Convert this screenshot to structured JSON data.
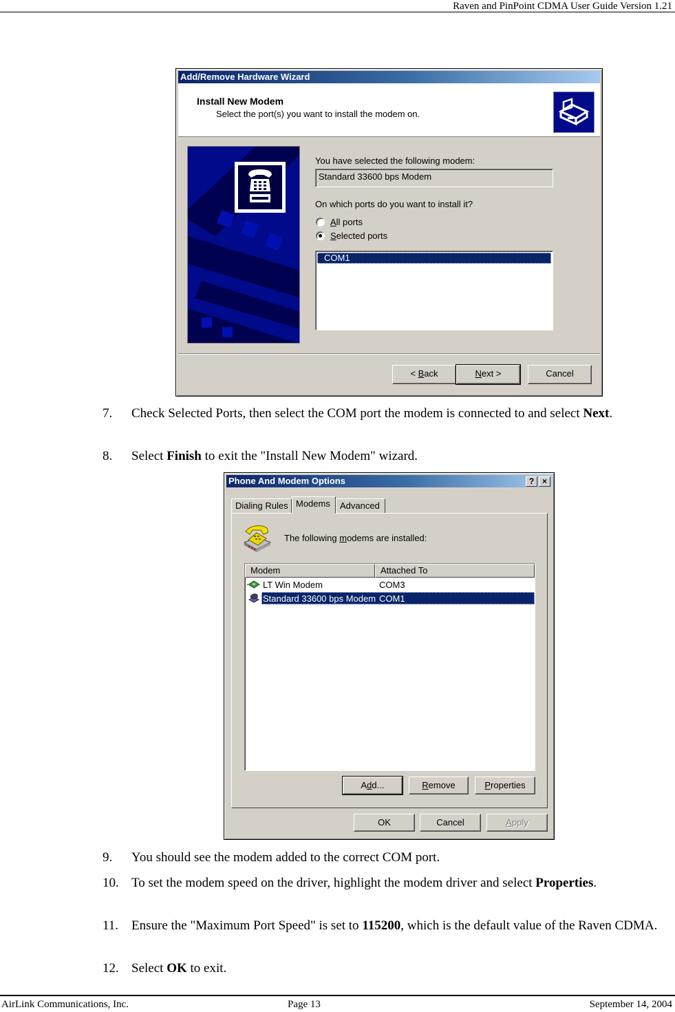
{
  "page": {
    "header": "Raven and PinPoint CDMA User Guide Version 1.21",
    "footer": {
      "company": "AirLink Communications, Inc.",
      "page": "Page 13",
      "date": "September 14, 2004"
    }
  },
  "wizard": {
    "title": "Add/Remove Hardware Wizard",
    "heading": "Install New Modem",
    "subheading": "Select the port(s) you want to install the modem on.",
    "selected_modem_label": "You have selected the following modem:",
    "selected_modem_value": "Standard 33600 bps Modem",
    "ports_question": "On which ports do you want to install it?",
    "radio_options": [
      {
        "label": "All ports",
        "accel": "A",
        "rest": "ll ports",
        "checked": false
      },
      {
        "label": "Selected ports",
        "accel": "S",
        "rest": "elected ports",
        "checked": true
      }
    ],
    "ports": [
      {
        "name": "COM1",
        "selected": true
      }
    ],
    "buttons": {
      "back": {
        "prefix": "< ",
        "accel": "B",
        "rest": "ack"
      },
      "next": {
        "accel": "N",
        "rest": "ext >"
      },
      "cancel": "Cancel"
    },
    "icons": {
      "header": "hardware-drive-icon",
      "art": "telephone-icon"
    }
  },
  "steps_a": [
    {
      "num": "7.",
      "parts": [
        {
          "t": "Check Selected Ports, then select the COM port the modem is connected to and select "
        },
        {
          "b": "Next"
        },
        {
          "t": "."
        }
      ]
    },
    {
      "num": "8.",
      "parts": [
        {
          "t": "Select "
        },
        {
          "b": "Finish"
        },
        {
          "t": " to exit the \"Install New Modem\" wizard."
        }
      ]
    }
  ],
  "phone_modem": {
    "title": "Phone And Modem Options",
    "title_buttons": {
      "help": "?",
      "close": "×"
    },
    "tabs": [
      {
        "label": "Dialing Rules",
        "active": false
      },
      {
        "label": "Modems",
        "active": true
      },
      {
        "label": "Advanced",
        "active": false
      }
    ],
    "message_pre": "The following ",
    "message_accel": "m",
    "message_post": "odems are  installed:",
    "columns": [
      "Modem",
      "Attached To"
    ],
    "rows": [
      {
        "modem": "LT Win Modem",
        "attached": "COM3",
        "selected": false,
        "icon": "modem-card-icon"
      },
      {
        "modem": "Standard 33600 bps Modem",
        "attached": "COM1",
        "selected": true,
        "icon": "external-modem-icon"
      }
    ],
    "buttons": {
      "add": {
        "pre": "A",
        "accel": "d",
        "post": "d..."
      },
      "remove": {
        "accel": "R",
        "rest": "emove"
      },
      "properties": {
        "accel": "P",
        "rest": "roperties"
      },
      "ok": "OK",
      "cancel": "Cancel",
      "apply": {
        "accel": "A",
        "rest": "pply",
        "disabled": true
      }
    }
  },
  "steps_b": [
    {
      "num": "9.",
      "parts": [
        {
          "t": "You should see the modem added to the correct COM port."
        }
      ]
    },
    {
      "num": "10.",
      "parts": [
        {
          "t": "To set the modem speed on the driver, highlight the modem driver and select "
        },
        {
          "b": "Properties"
        },
        {
          "t": "."
        }
      ]
    },
    {
      "num": "11.",
      "parts": [
        {
          "t": "Ensure the \"Maximum Port Speed\" is set to "
        },
        {
          "b": "115200"
        },
        {
          "t": ", which is the default value of the Raven CDMA."
        }
      ]
    },
    {
      "num": "12.",
      "parts": [
        {
          "t": "Select "
        },
        {
          "b": "OK"
        },
        {
          "t": " to exit."
        }
      ]
    }
  ],
  "colors": {
    "title_gradient_start": "#0a246a",
    "title_gradient_end": "#a6caf0",
    "dialog_face": "#d4d0c8",
    "selection": "#0a246a",
    "wizard_art": "#000a8a"
  }
}
